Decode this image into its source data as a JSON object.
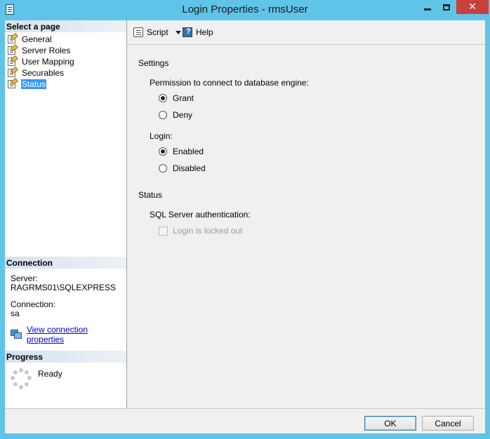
{
  "window": {
    "title": "Login Properties - rmsUser",
    "controls": {
      "minimize": "minimize",
      "maximize": "maximize",
      "close": "✕"
    }
  },
  "left_pane": {
    "select_page_header": "Select a page",
    "pages": [
      {
        "label": "General",
        "selected": false
      },
      {
        "label": "Server Roles",
        "selected": false
      },
      {
        "label": "User Mapping",
        "selected": false
      },
      {
        "label": "Securables",
        "selected": false
      },
      {
        "label": "Status",
        "selected": true
      }
    ],
    "connection_header": "Connection",
    "server_label": "Server:",
    "server_value": "RAGRMS01\\SQLEXPRESS",
    "connection_label": "Connection:",
    "connection_value": "sa",
    "view_connection_link": "View connection properties",
    "progress_header": "Progress",
    "progress_status": "Ready"
  },
  "toolbar": {
    "script_label": "Script",
    "help_label": "Help"
  },
  "settings": {
    "settings_header": "Settings",
    "permission_label": "Permission to connect to database engine:",
    "permission_options": [
      {
        "label": "Grant",
        "checked": true
      },
      {
        "label": "Deny",
        "checked": false
      }
    ],
    "login_label": "Login:",
    "login_options": [
      {
        "label": "Enabled",
        "checked": true
      },
      {
        "label": "Disabled",
        "checked": false
      }
    ],
    "status_header": "Status",
    "sql_auth_label": "SQL Server authentication:",
    "locked_out_label": "Login is locked out",
    "locked_out_checked": false,
    "locked_out_enabled": false
  },
  "footer": {
    "ok_label": "OK",
    "cancel_label": "Cancel"
  },
  "colors": {
    "title_bar": "#5fc4e8",
    "close_button": "#c7403a",
    "selection": "#3399ff",
    "link": "#0000cc"
  }
}
